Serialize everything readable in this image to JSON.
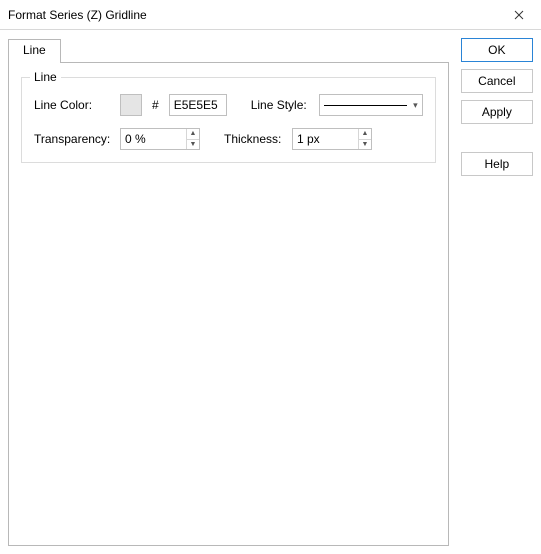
{
  "window": {
    "title": "Format Series (Z) Gridline"
  },
  "tabs": {
    "line": "Line"
  },
  "group": {
    "title": "Line",
    "lineColorLabel": "Line Color:",
    "hash": "#",
    "hexValue": "E5E5E5",
    "swatchColor": "#E5E5E5",
    "lineStyleLabel": "Line Style:",
    "transparencyLabel": "Transparency:",
    "transparencyValue": "0 %",
    "thicknessLabel": "Thickness:",
    "thicknessValue": "1 px"
  },
  "buttons": {
    "ok": "OK",
    "cancel": "Cancel",
    "apply": "Apply",
    "help": "Help"
  }
}
